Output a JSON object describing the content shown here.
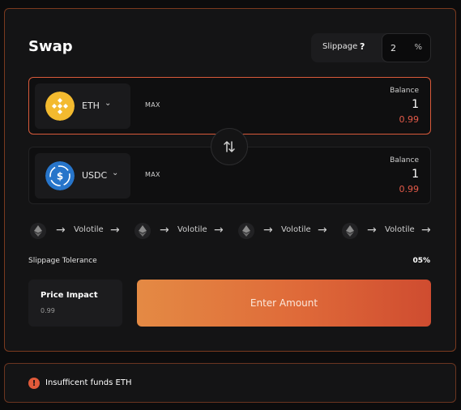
{
  "swap": {
    "title": "Swap",
    "slippage_label": "Slippage",
    "help_icon": "?",
    "slippage_value": "2",
    "slippage_unit": "%",
    "swap_direction_icon": "swap-vertical-icon"
  },
  "from_token": {
    "symbol": "ETH",
    "icon": "binance-coin-icon",
    "logo_color": "#F3BA2F",
    "max_label": "MAX",
    "balance_label": "Balance",
    "balance_value": "1",
    "balance_usd": "0.99"
  },
  "to_token": {
    "symbol": "USDC",
    "icon": "usdc-icon",
    "logo_color": "#2775CA",
    "max_label": "MAX",
    "balance_label": "Balance",
    "balance_value": "1",
    "balance_usd": "0.99"
  },
  "route": {
    "steps": [
      {
        "icon": "ethereum-icon",
        "label": "Volotile"
      },
      {
        "icon": "ethereum-icon",
        "label": "Volotile"
      },
      {
        "icon": "ethereum-icon",
        "label": "Volotile"
      },
      {
        "icon": "ethereum-icon",
        "label": "Volotile"
      }
    ]
  },
  "tolerance": {
    "label": "Slippage Tolerance",
    "value": "05%"
  },
  "price_impact": {
    "title": "Price Impact",
    "value": "0.99"
  },
  "actions": {
    "enter_amount_label": "Enter Amount"
  },
  "error": {
    "message": "Insufficent funds ETH",
    "icon_glyph": "!"
  },
  "colors": {
    "accent": "#E0643A",
    "error_text": "#E45A49",
    "background": "#141415"
  }
}
